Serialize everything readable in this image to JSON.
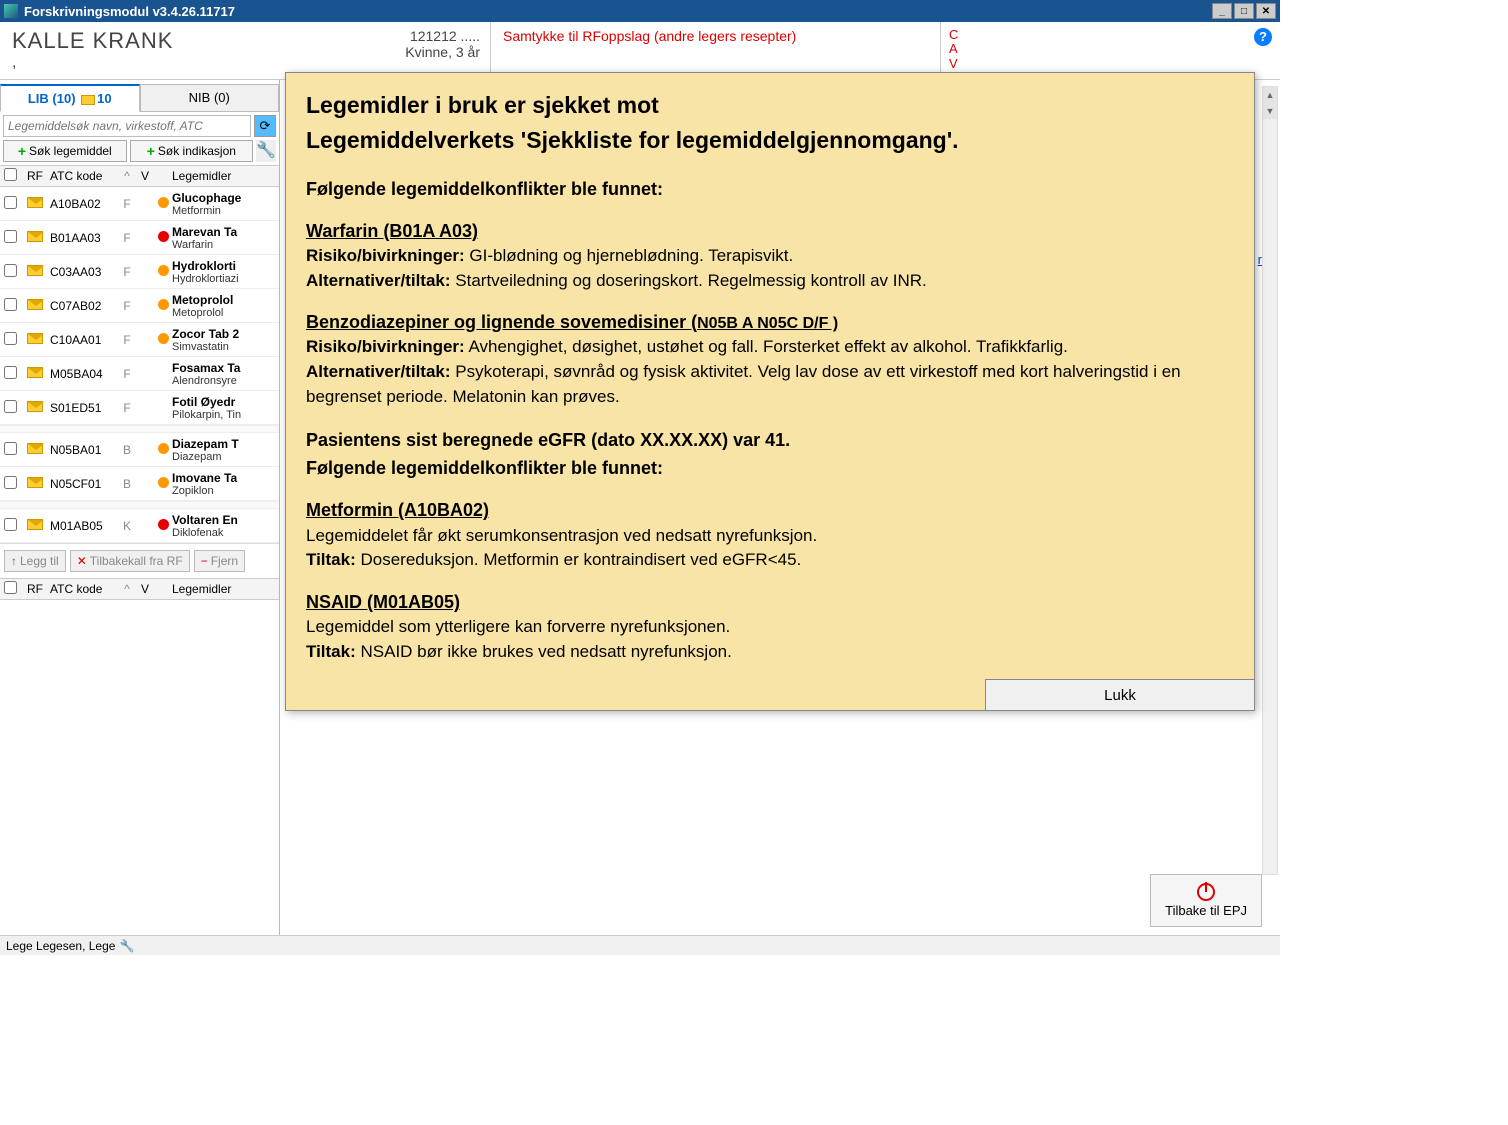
{
  "titlebar": {
    "text": "Forskrivningsmodul v3.4.26.11717"
  },
  "header": {
    "patient_name": "KALLE KRANK",
    "comma": ",",
    "demo_line1": "121212 .....",
    "demo_line2": "Kvinne, 3 år",
    "consent": "Samtykke til RFoppslag (andre legers resepter)",
    "cave": "C\nA\nV"
  },
  "tabs": {
    "lib_label": "LIB (10)",
    "lib_badge": "10",
    "nib_label": "NIB (0)"
  },
  "search": {
    "placeholder": "Legemiddelsøk navn, virkestoff, ATC",
    "btn_legemiddel": "Søk legemiddel",
    "btn_indikasjon": "Søk indikasjon"
  },
  "table": {
    "h_rf": "RF",
    "h_atc": "ATC kode",
    "h_sort": "^",
    "h_v": "V",
    "h_med": "Legemidler",
    "rows": [
      {
        "atc": "A10BA02",
        "v": "F",
        "dot": "orange",
        "name": "Glucophage",
        "sub": "Metformin"
      },
      {
        "atc": "B01AA03",
        "v": "F",
        "dot": "red",
        "name": "Marevan Ta",
        "sub": "Warfarin"
      },
      {
        "atc": "C03AA03",
        "v": "F",
        "dot": "orange",
        "name": "Hydroklorti",
        "sub": "Hydroklortiazi"
      },
      {
        "atc": "C07AB02",
        "v": "F",
        "dot": "orange",
        "name": "Metoprolol",
        "sub": "Metoprolol"
      },
      {
        "atc": "C10AA01",
        "v": "F",
        "dot": "orange",
        "name": "Zocor Tab 2",
        "sub": "Simvastatin"
      },
      {
        "atc": "M05BA04",
        "v": "F",
        "dot": "",
        "name": "Fosamax Ta",
        "sub": "Alendronsyre"
      },
      {
        "atc": "S01ED51",
        "v": "F",
        "dot": "",
        "name": "Fotil Øyedr",
        "sub": "Pilokarpin, Tin"
      },
      {
        "atc": "N05BA01",
        "v": "B",
        "dot": "orange",
        "name": "Diazepam T",
        "sub": "Diazepam"
      },
      {
        "atc": "N05CF01",
        "v": "B",
        "dot": "orange",
        "name": "Imovane Ta",
        "sub": "Zopiklon"
      },
      {
        "atc": "M01AB05",
        "v": "K",
        "dot": "red",
        "name": "Voltaren En",
        "sub": "Diklofenak"
      }
    ]
  },
  "actions": {
    "legg_til": "Legg til",
    "tilbakekall": "Tilbakekall fra RF",
    "fjern": "Fjern"
  },
  "rightpane": {
    "link_r": "r",
    "back_btn": "Tilbake til EPJ"
  },
  "statusbar": {
    "text": "Lege Legesen, Lege"
  },
  "modal": {
    "title1": "Legemidler i bruk er sjekket mot",
    "title2": "Legemiddelverkets 'Sjekkliste for legemiddelgjennomgang'.",
    "conflicts_heading": "Følgende legemiddelkonflikter ble funnet:",
    "d1_name": "Warfarin (B01A A03)",
    "d1_r_lbl": "Risiko/bivirkninger:",
    "d1_r_txt": " GI-blødning og hjerneblødning. Terapisvikt.",
    "d1_a_lbl": "Alternativer/tiltak:",
    "d1_a_txt": " Startveiledning og doseringskort. Regelmessig kontroll av INR.",
    "d2_name": "Benzodiazepiner og lignende sovemedisiner (",
    "d2_code": "N05B A N05C D/F )",
    "d2_r_lbl": "Risiko/bivirkninger:",
    "d2_r_txt": " Avhengighet, døsighet, ustøhet og fall. Forsterket effekt av alkohol. Trafikkfarlig.",
    "d2_a_lbl": "Alternativer/tiltak:",
    "d2_a_txt": " Psykoterapi, søvnråd og fysisk aktivitet. Velg lav dose av ett virkestoff med kort halveringstid i en begrenset periode. Melatonin kan prøves.",
    "egfr_line": "Pasientens sist beregnede eGFR (dato XX.XX.XX) var 41.",
    "conflicts_heading2": "Følgende legemiddelkonflikter ble funnet:",
    "d3_name": "Metformin (A10BA02)",
    "d3_txt": "Legemiddelet får økt serumkonsentrasjon ved nedsatt nyrefunksjon.",
    "d3_t_lbl": "Tiltak:",
    "d3_t_txt": " Dosereduksjon. Metformin er kontraindisert ved eGFR<45.",
    "d4_name": "NSAID (M01AB05)",
    "d4_txt": "Legemiddel som ytterligere kan forverre nyrefunksjonen.",
    "d4_t_lbl": "Tiltak:",
    "d4_t_txt": " NSAID bør ikke brukes ved nedsatt nyrefunksjon.",
    "close": "Lukk"
  }
}
